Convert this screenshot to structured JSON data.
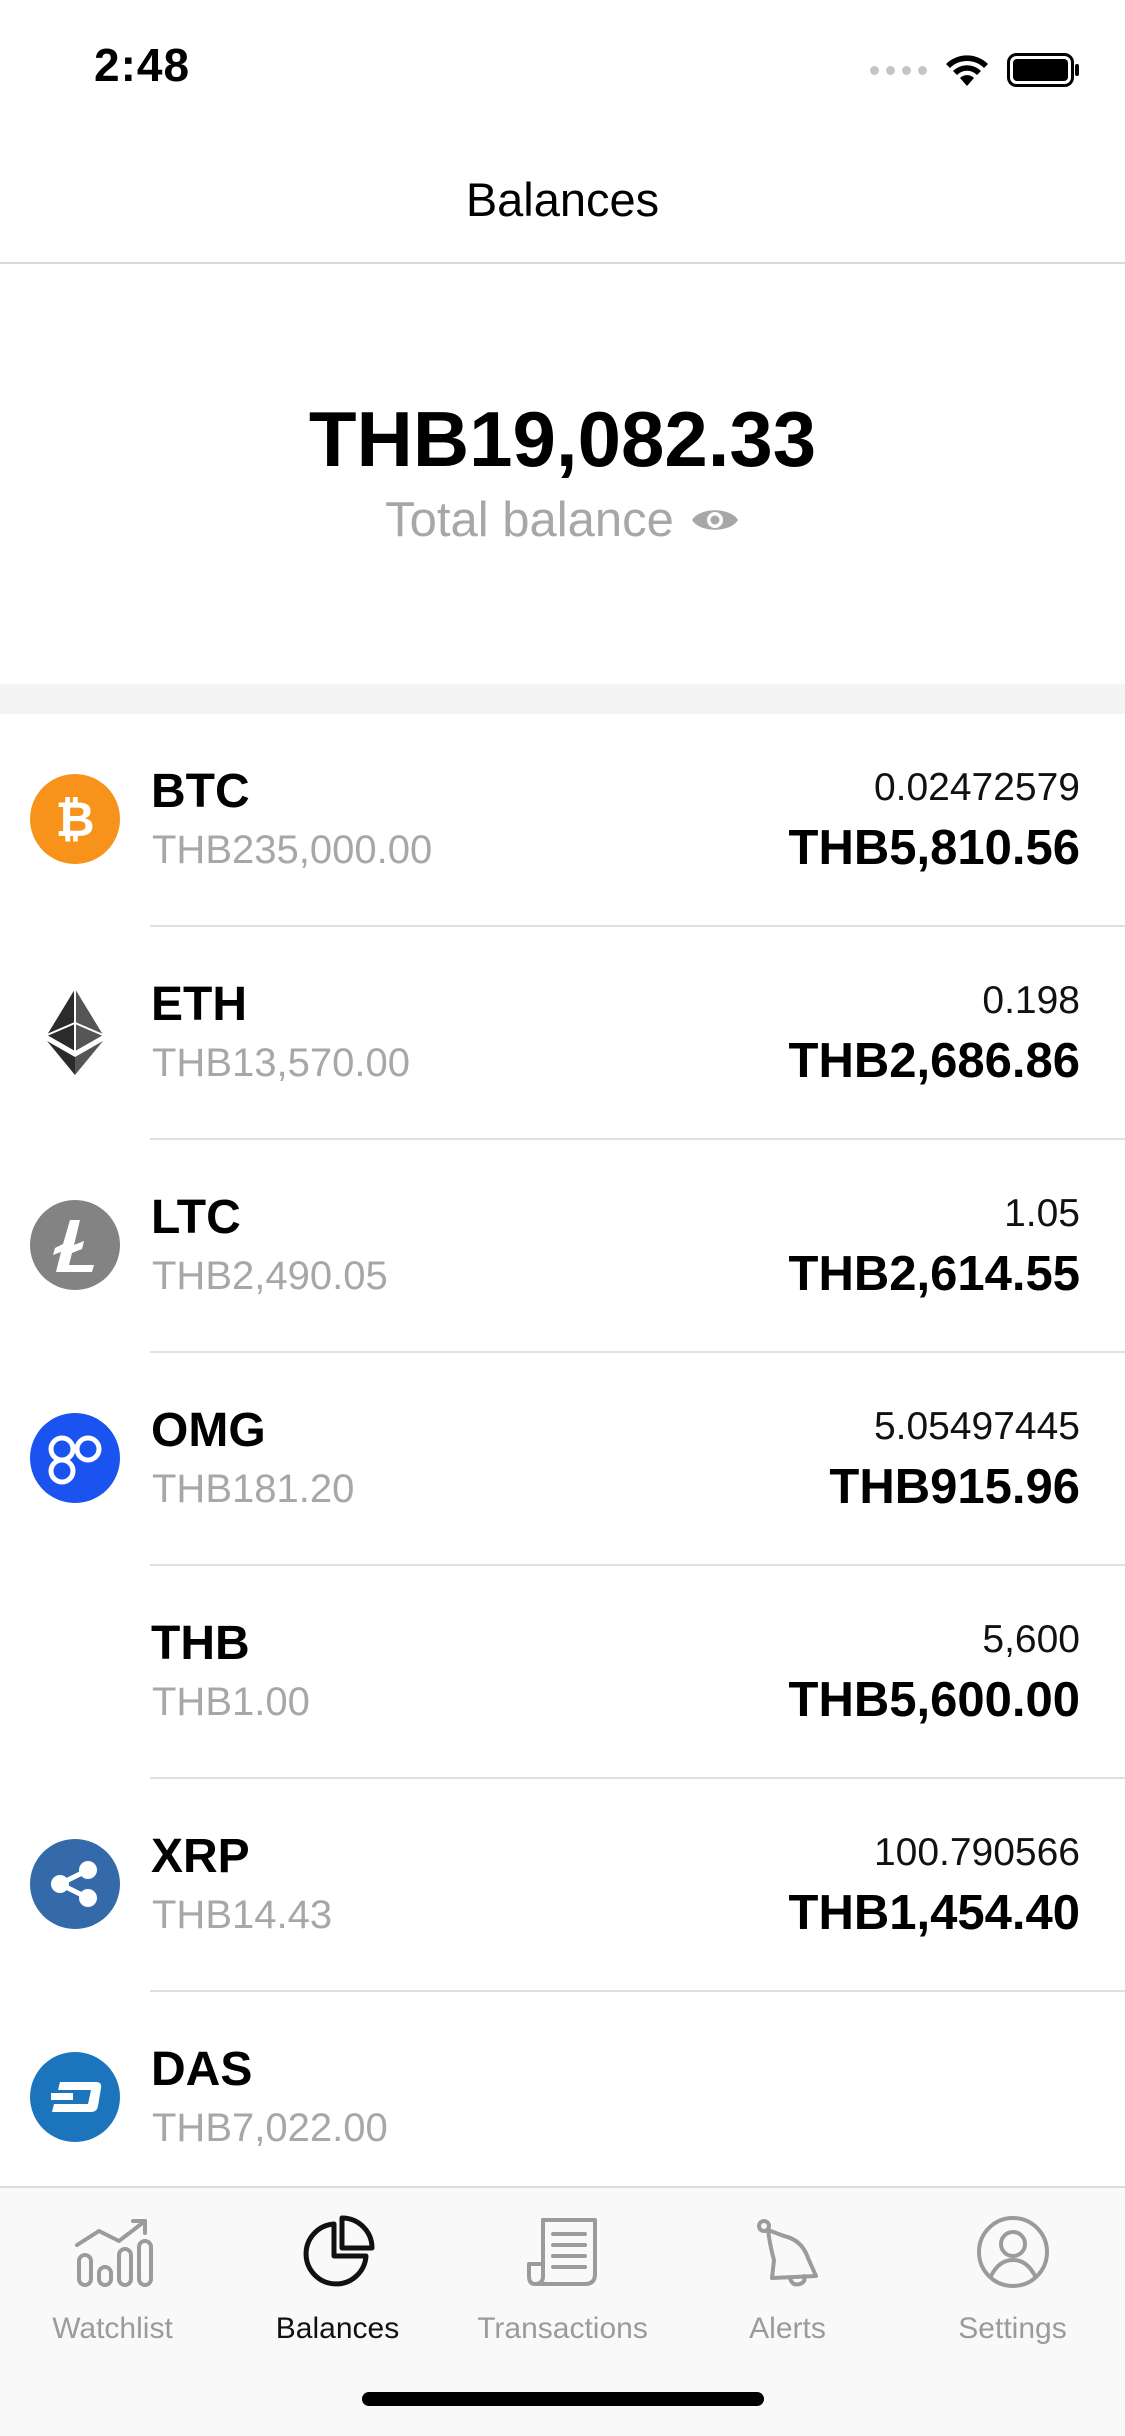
{
  "status_bar": {
    "time": "2:48"
  },
  "nav": {
    "title": "Balances"
  },
  "summary": {
    "total_amount": "THB19,082.33",
    "total_label": "Total balance"
  },
  "balances": [
    {
      "symbol": "BTC",
      "price": "THB235,000.00",
      "amount": "0.02472579",
      "value": "THB5,810.56",
      "icon": "bitcoin-icon",
      "color": "#f7931a"
    },
    {
      "symbol": "ETH",
      "price": "THB13,570.00",
      "amount": "0.198",
      "value": "THB2,686.86",
      "icon": "ethereum-icon",
      "color": "#2b2b2b"
    },
    {
      "symbol": "LTC",
      "price": "THB2,490.05",
      "amount": "1.05",
      "value": "THB2,614.55",
      "icon": "litecoin-icon",
      "color": "#838383"
    },
    {
      "symbol": "OMG",
      "price": "THB181.20",
      "amount": "5.05497445",
      "value": "THB915.96",
      "icon": "omisego-icon",
      "color": "#1a53f0"
    },
    {
      "symbol": "THB",
      "price": "THB1.00",
      "amount": "5,600",
      "value": "THB5,600.00",
      "icon": "",
      "color": ""
    },
    {
      "symbol": "XRP",
      "price": "THB14.43",
      "amount": "100.790566",
      "value": "THB1,454.40",
      "icon": "ripple-icon",
      "color": "#346aa9"
    },
    {
      "symbol": "DAS",
      "price": "THB7,022.00",
      "amount": "",
      "value": "",
      "icon": "dash-icon",
      "color": "#1c75bc"
    }
  ],
  "tabs": [
    {
      "label": "Watchlist",
      "icon": "chart-icon",
      "active": false
    },
    {
      "label": "Balances",
      "icon": "pie-chart-icon",
      "active": true
    },
    {
      "label": "Transactions",
      "icon": "document-icon",
      "active": false
    },
    {
      "label": "Alerts",
      "icon": "bell-icon",
      "active": false
    },
    {
      "label": "Settings",
      "icon": "user-circle-icon",
      "active": false
    }
  ],
  "colors": {
    "accent_text": "#000000",
    "secondary_text": "#a7a7a7",
    "tab_inactive": "#9b9b9b"
  }
}
